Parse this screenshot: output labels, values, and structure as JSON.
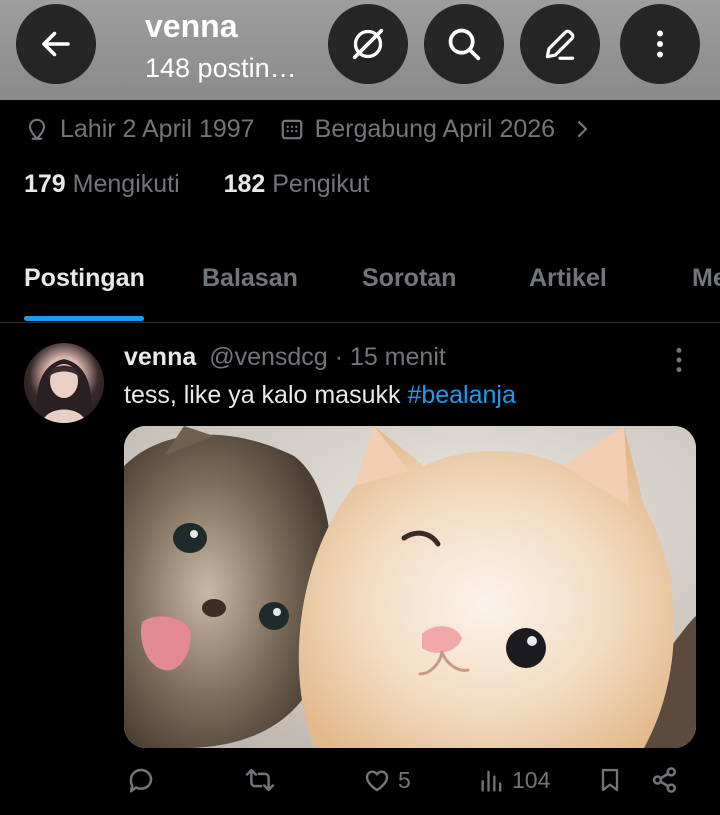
{
  "header": {
    "title": "venna",
    "subtitle": "148 postin…"
  },
  "profile": {
    "birth": "Lahir 2 April 1997",
    "joined": "Bergabung April 2026",
    "following_count": "179",
    "following_label": "Mengikuti",
    "followers_count": "182",
    "followers_label": "Pengikut"
  },
  "tabs": [
    {
      "label": "Postingan",
      "active": true
    },
    {
      "label": "Balasan"
    },
    {
      "label": "Sorotan"
    },
    {
      "label": "Artikel"
    },
    {
      "label": "Me"
    }
  ],
  "post": {
    "name": "venna",
    "handle_time": "@vensdcg · 15 menit",
    "text": "tess, like ya kalo masukk ",
    "hashtag": "#bealanja",
    "likes": "5",
    "views": "104"
  },
  "colors": {
    "accent": "#1d9bf0",
    "muted": "#71767b",
    "background": "#000000"
  }
}
